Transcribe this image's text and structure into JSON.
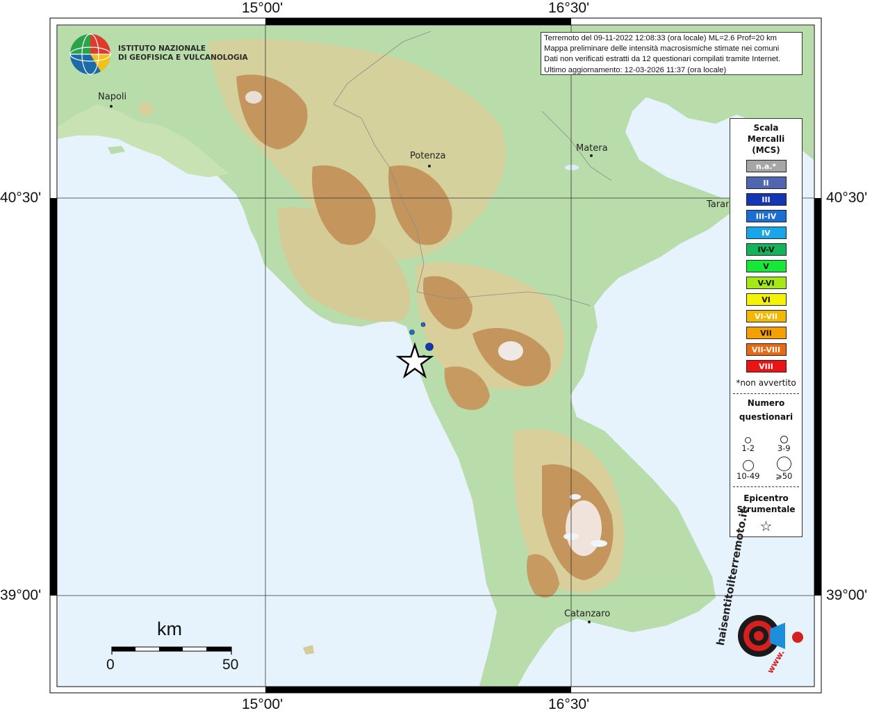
{
  "header": {
    "lines": [
      "Terremoto del 09-11-2022 12:08:33 (ora locale) ML=2.6 Prof=20 km",
      "Mappa preliminare delle intensità macrosismiche stimate nei comuni",
      "Dati non verificati estratti da 12 questionari compilati tramite Internet.",
      "Ultimo aggiornamento: 12-03-2026 11:37 (ora locale)"
    ]
  },
  "coords": {
    "top_left": "15°00'",
    "top_right": "16°30'",
    "bottom_left": "15°00'",
    "bottom_right": "16°30'",
    "left_upper": "40°30'",
    "left_lower": "39°00'",
    "right_upper": "40°30'",
    "right_lower": "39°00'"
  },
  "cities": {
    "napoli": "Napoli",
    "potenza": "Potenza",
    "matera": "Matera",
    "taranto": "Taranto",
    "catanzaro": "Catanzaro"
  },
  "logo": {
    "line1": "ISTITUTO NAZIONALE",
    "line2": "DI GEOFISICA E VULCANOLOGIA"
  },
  "legend": {
    "title1": "Scala",
    "title2": "Mercalli",
    "title3": "(MCS)",
    "scale": [
      {
        "label": "n.a.*",
        "color": "#a6a6a6",
        "text_color": "#ffffff"
      },
      {
        "label": "II",
        "color": "#4f66b0",
        "text_color": "#ffffff"
      },
      {
        "label": "III",
        "color": "#1436b4",
        "text_color": "#ffffff"
      },
      {
        "label": "III-IV",
        "color": "#1a6ed4",
        "text_color": "#ffffff"
      },
      {
        "label": "IV",
        "color": "#18a6ea",
        "text_color": "#ffffff"
      },
      {
        "label": "IV-V",
        "color": "#11b45a",
        "text_color": "#111111"
      },
      {
        "label": "V",
        "color": "#16e83a",
        "text_color": "#111111"
      },
      {
        "label": "V-VI",
        "color": "#a4ea12",
        "text_color": "#111111"
      },
      {
        "label": "VI",
        "color": "#f4f400",
        "text_color": "#111111"
      },
      {
        "label": "VI-VII",
        "color": "#f4b800",
        "text_color": "#ffffff"
      },
      {
        "label": "VII",
        "color": "#f4a000",
        "text_color": "#111111"
      },
      {
        "label": "VII-VIII",
        "color": "#ea6a14",
        "text_color": "#ffffff"
      },
      {
        "label": "VIII",
        "color": "#ea1414",
        "text_color": "#ffffff"
      }
    ],
    "note": "*non avvertito",
    "questionari_title1": "Numero",
    "questionari_title2": "questionari",
    "q_sizes": [
      "1-2",
      "3-9",
      "10-49",
      "⩾50"
    ],
    "epicentro_title1": "Epicentro",
    "epicentro_title2": "Strumentale",
    "epicentro_symbol": "☆"
  },
  "scale_bar": {
    "unit": "km",
    "start": "0",
    "end": "50"
  },
  "colors": {
    "sea": "#e6f2fc",
    "low_land": "#b8dcaa",
    "hill": "#d8cf9a",
    "mountain": "#c4955c",
    "peak": "#efe9e6",
    "intensity_iii": "#1436b4",
    "intensity_iii_iv": "#1a6ed4"
  },
  "site_badge": {
    "text": "haisentitoilterremoto.it",
    "url_text": "www."
  }
}
